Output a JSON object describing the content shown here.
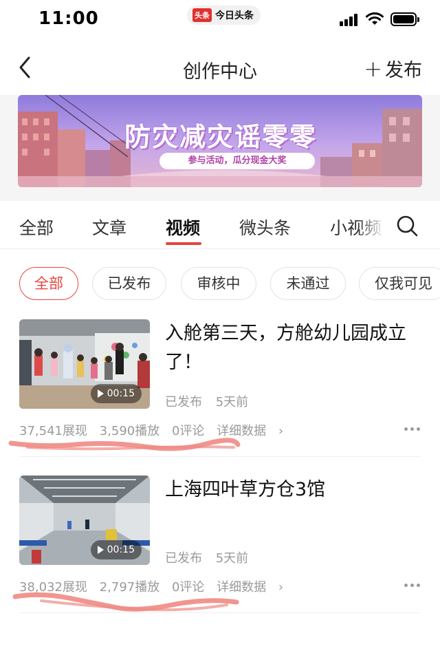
{
  "status_bar": {
    "time": "11:00",
    "app_badge": "头条",
    "app_name": "今日头条",
    "icons": [
      "signal-icon",
      "wifi-icon",
      "battery-icon"
    ]
  },
  "nav": {
    "back_icon": "chevron-left-icon",
    "title": "创作中心",
    "publish_label": "发布",
    "publish_icon": "plus-icon"
  },
  "banner": {
    "title": "防灾减灾谣零零",
    "subtitle": "参与活动，瓜分现金大奖"
  },
  "tabs": {
    "items": [
      {
        "label": "全部"
      },
      {
        "label": "文章"
      },
      {
        "label": "视频"
      },
      {
        "label": "微头条"
      },
      {
        "label": "小视频"
      }
    ],
    "active": "视频",
    "search_icon": "search-icon"
  },
  "filters": {
    "items": [
      {
        "label": "全部"
      },
      {
        "label": "已发布"
      },
      {
        "label": "审核中"
      },
      {
        "label": "未通过"
      },
      {
        "label": "仅我可见"
      }
    ],
    "active": "全部"
  },
  "videos": [
    {
      "title": "入舱第三天，方舱幼儿园成立了！",
      "duration": "00:15",
      "status": "已发布",
      "time": "5天前",
      "impressions": "37,541展现",
      "plays": "3,590播放",
      "comments": "0评论",
      "detail_label": "详细数据"
    },
    {
      "title": "上海四叶草方仓3馆",
      "duration": "00:15",
      "status": "已发布",
      "time": "5天前",
      "impressions": "38,032展现",
      "plays": "2,797播放",
      "comments": "0评论",
      "detail_label": "详细数据"
    }
  ],
  "colors": {
    "accent": "#e8433e",
    "annotation": "#f08a84",
    "muted_text": "#9a9a9a"
  }
}
